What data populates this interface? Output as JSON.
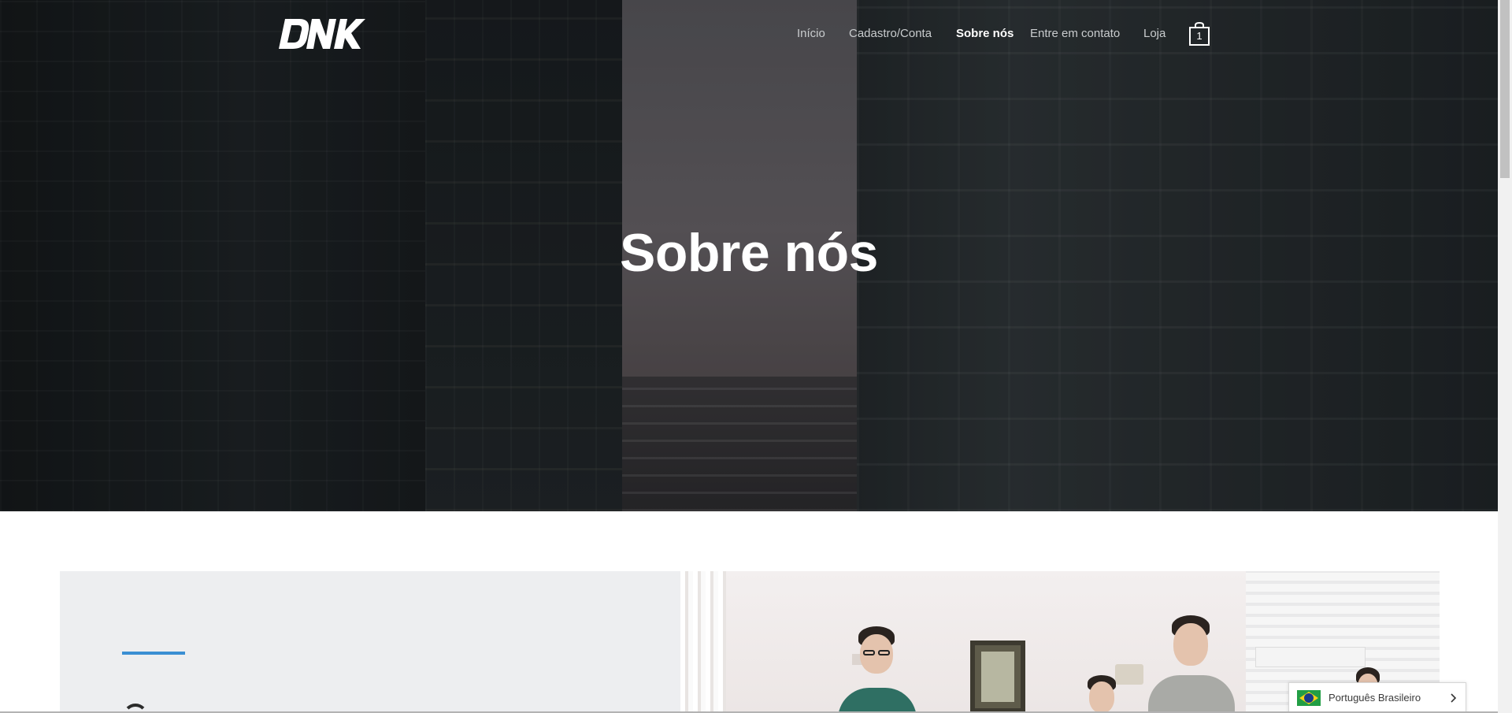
{
  "site": {
    "logo_text": "DNK"
  },
  "nav": {
    "items": [
      {
        "label": "Início"
      },
      {
        "label": "Cadastro/Conta"
      },
      {
        "label": "Sobre nós",
        "active": true
      },
      {
        "label": "Entre em contato"
      },
      {
        "label": "Loja"
      }
    ],
    "cart_count": "1",
    "cart_icon": "shopping-bag-icon"
  },
  "hero": {
    "title": "Sobre nós"
  },
  "content": {
    "accent_color": "#3a8fd3"
  },
  "language_switcher": {
    "label": "Português Brasileiro",
    "flag_icon": "brazil-flag-icon",
    "chevron_icon": "chevron-right-icon"
  },
  "colors": {
    "nav_text": "#c9ccce",
    "nav_active": "#ffffff",
    "card_bg": "#edeef0"
  }
}
